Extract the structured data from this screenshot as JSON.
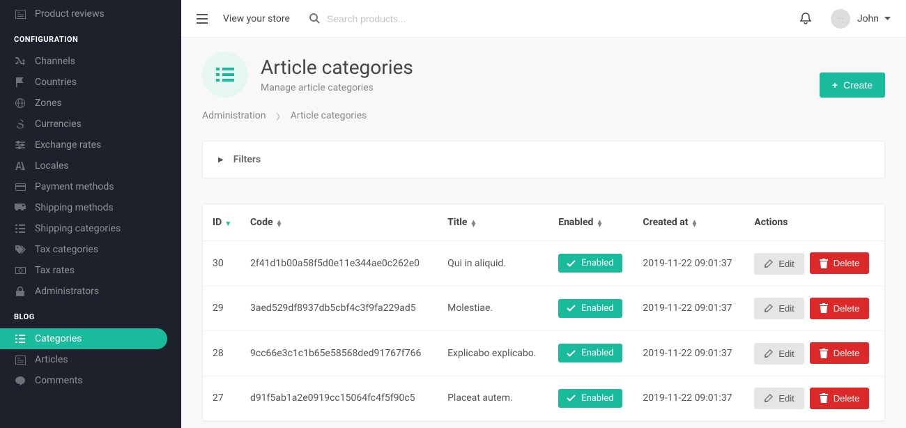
{
  "sidebar": {
    "product_reviews": "Product reviews",
    "section_config": "CONFIGURATION",
    "channels": "Channels",
    "countries": "Countries",
    "zones": "Zones",
    "currencies": "Currencies",
    "exchange_rates": "Exchange rates",
    "locales": "Locales",
    "payment_methods": "Payment methods",
    "shipping_methods": "Shipping methods",
    "shipping_categories": "Shipping categories",
    "tax_categories": "Tax categories",
    "tax_rates": "Tax rates",
    "administrators": "Administrators",
    "section_blog": "BLOG",
    "blog_categories": "Categories",
    "blog_articles": "Articles",
    "blog_comments": "Comments"
  },
  "topbar": {
    "view_store": "View your store",
    "search_placeholder": "Search products...",
    "username": "John"
  },
  "page": {
    "title": "Article categories",
    "subtitle": "Manage article categories",
    "create_label": "Create"
  },
  "breadcrumb": {
    "root": "Administration",
    "current": "Article categories"
  },
  "filters": {
    "label": "Filters"
  },
  "table": {
    "headers": {
      "id": "ID",
      "code": "Code",
      "title": "Title",
      "enabled": "Enabled",
      "created_at": "Created at",
      "actions": "Actions"
    },
    "enabled_badge": "Enabled",
    "edit_btn": "Edit",
    "delete_btn": "Delete",
    "rows": [
      {
        "id": "30",
        "code": "2f41d1b00a58f5d0e11e344ae0c262e0",
        "title": "Qui in aliquid.",
        "created_at": "2019-11-22 09:01:37"
      },
      {
        "id": "29",
        "code": "3aed529df8937db5cbf4c3f9fa229ad5",
        "title": "Molestiae.",
        "created_at": "2019-11-22 09:01:37"
      },
      {
        "id": "28",
        "code": "9cc66e3c1c1b65e58568ded91767f766",
        "title": "Explicabo explicabo.",
        "created_at": "2019-11-22 09:01:37"
      },
      {
        "id": "27",
        "code": "d91f5ab1a2e0919cc15064fc4f5f90c5",
        "title": "Placeat autem.",
        "created_at": "2019-11-22 09:01:37"
      }
    ]
  }
}
